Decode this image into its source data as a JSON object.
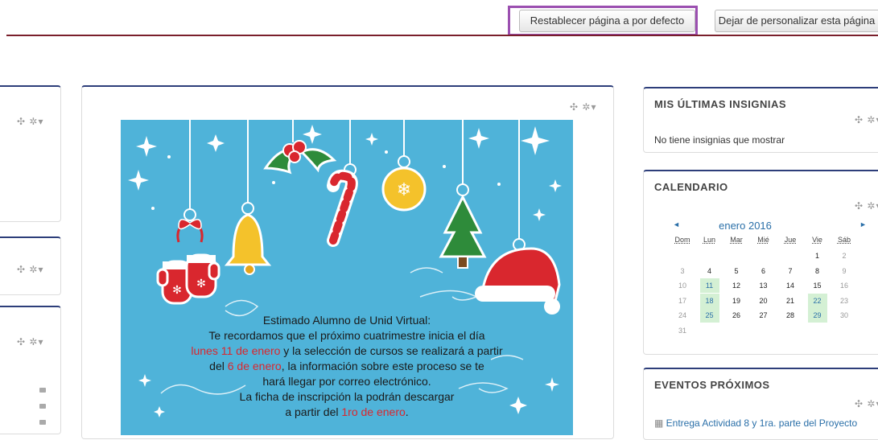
{
  "header": {
    "reset_button": "Restablecer página a por defecto",
    "stop_customize_button": "Dejar de personalizar esta página"
  },
  "block_controls": "✣ ✲▾",
  "christmas_message": {
    "line1": "Estimado Alumno de Unid Virtual:",
    "line2": "Te recordamos que el próximo cuatrimestre inicia el día",
    "line3_red": "lunes 11 de enero",
    "line3_rest": " y la selección de cursos se realizará a partir",
    "line4_pre": "del ",
    "line4_red": "6 de enero",
    "line4_rest": ", la información sobre este proceso se te",
    "line5": "hará llegar por correo electrónico.",
    "line6": "La ficha de inscripción la podrán descargar",
    "line7_pre": "a partir del ",
    "line7_red": "1ro de enero",
    "line7_post": "."
  },
  "badges": {
    "title": "MIS ÚLTIMAS INSIGNIAS",
    "empty_text": "No tiene insignias que mostrar"
  },
  "calendar": {
    "title": "CALENDARIO",
    "month": "enero 2016",
    "prev": "◄",
    "next": "►",
    "weekdays": [
      "Dom",
      "Lun",
      "Mar",
      "Mié",
      "Jue",
      "Vie",
      "Sáb"
    ],
    "weeks": [
      [
        "",
        "",
        "",
        "",
        "",
        "1",
        "2"
      ],
      [
        "3",
        "4",
        "5",
        "6",
        "7",
        "8",
        "9"
      ],
      [
        "10",
        "11",
        "12",
        "13",
        "14",
        "15",
        "16"
      ],
      [
        "17",
        "18",
        "19",
        "20",
        "21",
        "22",
        "23"
      ],
      [
        "24",
        "25",
        "26",
        "27",
        "28",
        "29",
        "30"
      ],
      [
        "31",
        "",
        "",
        "",
        "",
        "",
        ""
      ]
    ],
    "highlighted_days": [
      "11",
      "18",
      "22",
      "25",
      "29"
    ]
  },
  "events": {
    "title": "EVENTOS PRÓXIMOS",
    "first_event": "Entrega Actividad 8 y 1ra. parte del Proyecto"
  },
  "colors": {
    "header_rule": "#7a1f2b",
    "block_top": "#2d3e7a",
    "poster_bg": "#4fb3d9",
    "highlight_frame": "#9b4fb0",
    "red_text": "#d9272e"
  }
}
